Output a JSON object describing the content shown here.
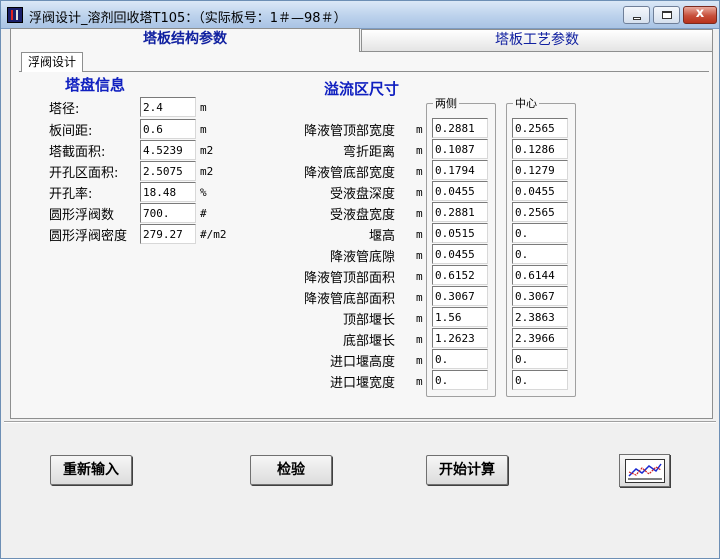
{
  "window": {
    "title": "浮阀设计_溶剂回收塔T105：（实际板号：1＃—98＃）",
    "close_glyph": "x"
  },
  "tabs": [
    {
      "label": "塔板结构参数",
      "active": true
    },
    {
      "label": "塔板工艺参数",
      "active": false
    }
  ],
  "subtab": {
    "label": "浮阀设计"
  },
  "tray_info": {
    "title": "塔盘信息",
    "rows": [
      {
        "label": "塔径:",
        "value": "2.4",
        "unit": "m"
      },
      {
        "label": "板间距:",
        "value": "0.6",
        "unit": "m"
      },
      {
        "label": "塔截面积:",
        "value": "4.5239",
        "unit": "m2"
      },
      {
        "label": "开孔区面积:",
        "value": "2.5075",
        "unit": "m2"
      },
      {
        "label": "开孔率:",
        "value": "18.48",
        "unit": "%"
      },
      {
        "label": "圆形浮阀数",
        "value": "700.",
        "unit": "#"
      },
      {
        "label": "圆形浮阀密度",
        "value": "279.27",
        "unit": "#/m2"
      }
    ]
  },
  "overflow": {
    "title": "溢流区尺寸",
    "col_side": "两侧",
    "col_center": "中心",
    "rows": [
      {
        "label": "降液管顶部宽度",
        "unit": "m",
        "side": "0.2881",
        "center": "0.2565"
      },
      {
        "label": "弯折距离",
        "unit": "m",
        "side": "0.1087",
        "center": "0.1286"
      },
      {
        "label": "降液管底部宽度",
        "unit": "m",
        "side": "0.1794",
        "center": "0.1279"
      },
      {
        "label": "受液盘深度",
        "unit": "m",
        "side": "0.0455",
        "center": "0.0455"
      },
      {
        "label": "受液盘宽度",
        "unit": "m",
        "side": "0.2881",
        "center": "0.2565"
      },
      {
        "label": "堰高",
        "unit": "m",
        "side": "0.0515",
        "center": "0."
      },
      {
        "label": "降液管底隙",
        "unit": "m",
        "side": "0.0455",
        "center": "0."
      },
      {
        "label": "降液管顶部面积",
        "unit": "m",
        "side": "0.6152",
        "center": "0.6144"
      },
      {
        "label": "降液管底部面积",
        "unit": "m",
        "side": "0.3067",
        "center": "0.3067"
      },
      {
        "label": "顶部堰长",
        "unit": "m",
        "side": "1.56",
        "center": "2.3863"
      },
      {
        "label": "底部堰长",
        "unit": "m",
        "side": "1.2623",
        "center": "2.3966"
      },
      {
        "label": "进口堰高度",
        "unit": "m",
        "side": "0.",
        "center": "0."
      },
      {
        "label": "进口堰宽度",
        "unit": "m",
        "side": "0.",
        "center": "0."
      }
    ]
  },
  "buttons": {
    "reset": "重新输入",
    "check": "检验",
    "calculate": "开始计算",
    "chart_icon": "line-chart-icon"
  },
  "colors": {
    "section_title": "#1020c0",
    "tab_text": "#1020a0"
  }
}
